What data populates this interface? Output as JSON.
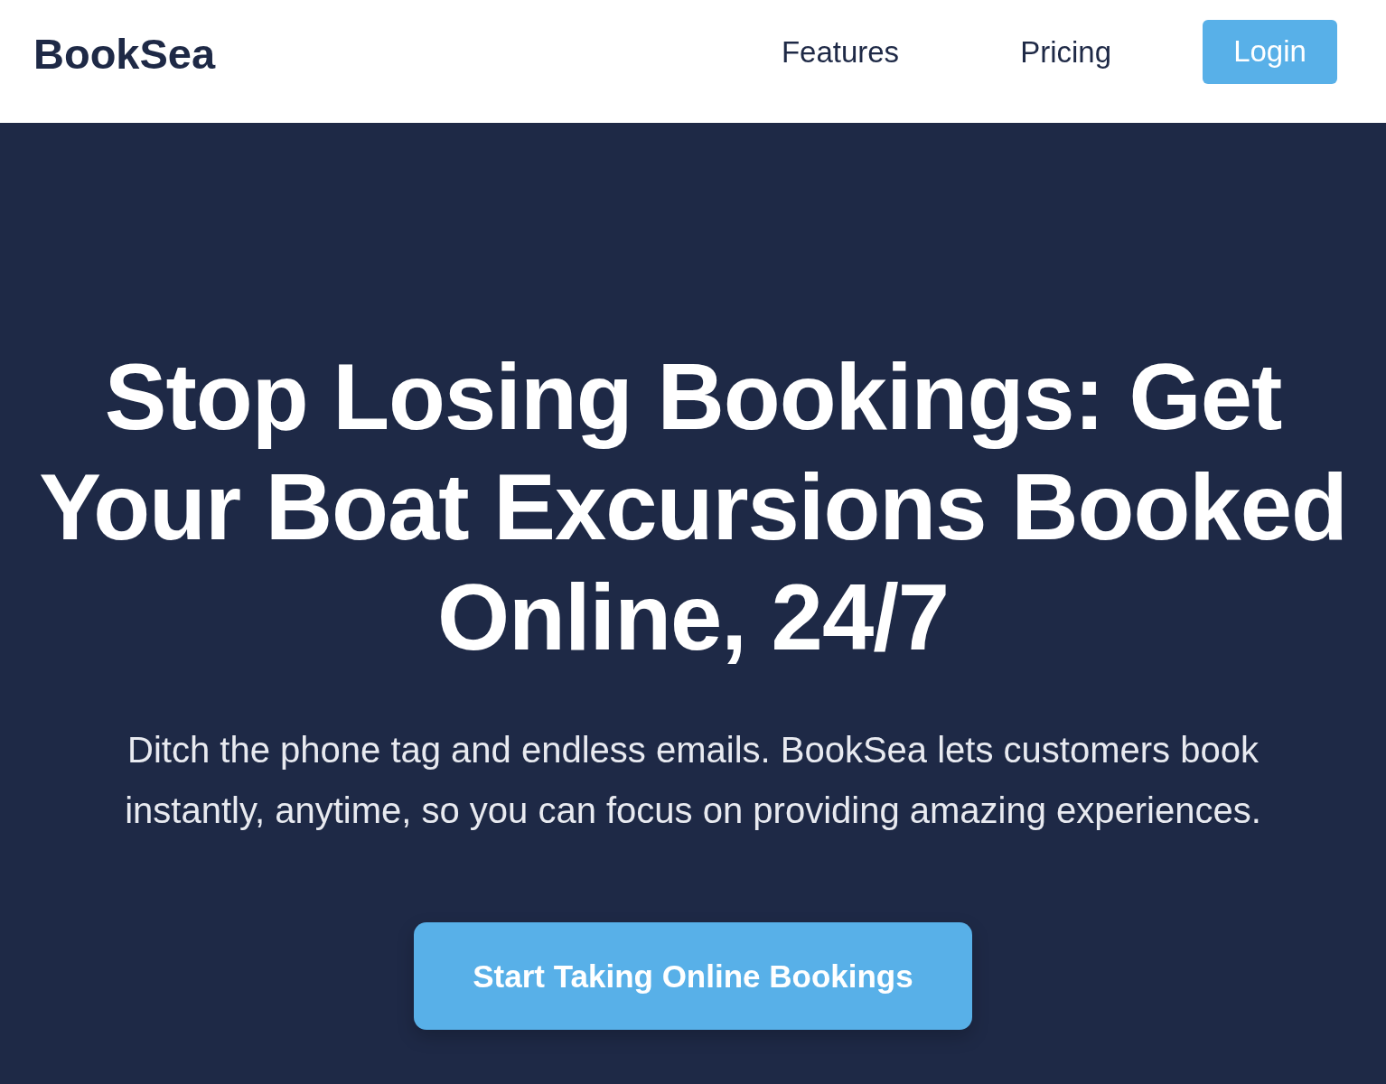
{
  "header": {
    "logo": "BookSea",
    "nav": [
      {
        "label": "Features",
        "kind": "link"
      },
      {
        "label": "Pricing",
        "kind": "link"
      },
      {
        "label": "Login",
        "kind": "button"
      }
    ]
  },
  "hero": {
    "headline": "Stop Losing Bookings: Get Your Boat Excursions Booked Online, 24/7",
    "subtext": "Ditch the phone tag and endless emails. BookSea lets customers book instantly, anytime, so you can focus on providing amazing experiences.",
    "cta": "Start Taking Online Bookings"
  }
}
